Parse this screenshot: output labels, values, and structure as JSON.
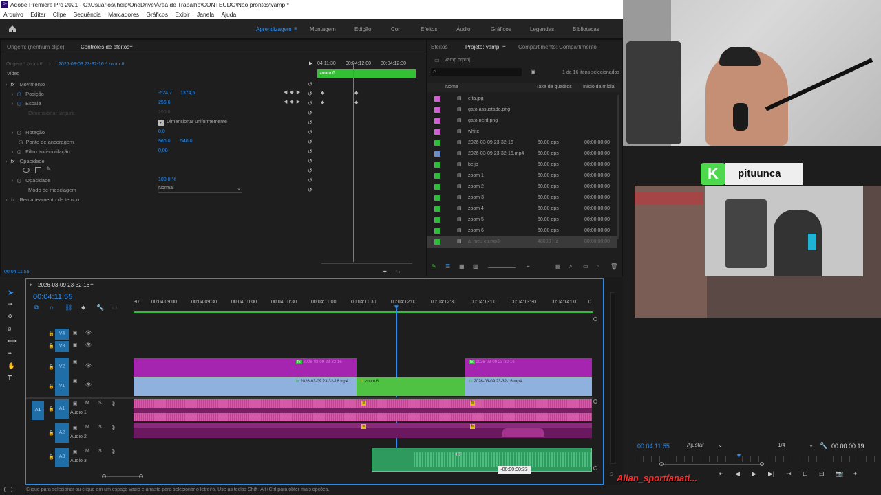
{
  "window": {
    "title": "Adobe Premiere Pro 2021 - C:\\Usuários\\jheip\\OneDrive\\Área de Trabalho\\CONTEUDO\\Não prontos\\vamp *",
    "app_badge": "Pr"
  },
  "menu": [
    "Arquivo",
    "Editar",
    "Clipe",
    "Sequência",
    "Marcadores",
    "Gráficos",
    "Exibir",
    "Janela",
    "Ajuda"
  ],
  "workspaces": [
    "Aprendizagem",
    "Montagem",
    "Edição",
    "Cor",
    "Efeitos",
    "Áudio",
    "Gráficos",
    "Legendas",
    "Bibliotecas"
  ],
  "effects_panel": {
    "tabs": [
      "Origem: (nenhum clipe)",
      "Controles de efeitos"
    ],
    "master": "Origem * zoom 6",
    "clip": "2026-03-09 23-32-16 * zoom 6",
    "video_label": "Vídeo",
    "clip_bar_label": "zoom 6",
    "times": [
      "04:11:30",
      "00:04:12:00",
      "00:04:12:30"
    ],
    "rows": [
      {
        "label": "Movimento",
        "v1": "",
        "v2": ""
      },
      {
        "label": "Posição",
        "v1": "-524,7",
        "v2": "1374,5"
      },
      {
        "label": "Escala",
        "v1": "255,6",
        "v2": ""
      },
      {
        "label": "Dimensionar largura",
        "v1": "100,0",
        "v2": ""
      },
      {
        "label": "Dimensionar uniformemente",
        "v1": "",
        "v2": ""
      },
      {
        "label": "Rotação",
        "v1": "0,0",
        "v2": ""
      },
      {
        "label": "Ponto de ancoragem",
        "v1": "960,0",
        "v2": "540,0"
      },
      {
        "label": "Filtro anti-cintilação",
        "v1": "0,00",
        "v2": ""
      },
      {
        "label": "Opacidade",
        "v1": "",
        "v2": ""
      },
      {
        "label": "Opacidade",
        "v1": "100,0 %",
        "v2": ""
      },
      {
        "label": "Modo de mesclagem",
        "v1": "Normal",
        "v2": ""
      },
      {
        "label": "Remapeamento de tempo",
        "v1": "",
        "v2": ""
      }
    ],
    "timecode": "00:04:11:55"
  },
  "project_panel": {
    "tabs": [
      "Efeitos",
      "Projeto: vamp",
      "Compartimento: Compartimento"
    ],
    "file": "vamp.prproj",
    "selection": "1 de 16 itens selecionados",
    "columns": [
      "Nome",
      "Taxa de quadros",
      "Início da mídia"
    ],
    "items": [
      {
        "name": "eita.jpg",
        "rate": "",
        "start": "",
        "color": "#d05fd0"
      },
      {
        "name": "gato assustado.png",
        "rate": "",
        "start": "",
        "color": "#d05fd0"
      },
      {
        "name": "gato nerd.png",
        "rate": "",
        "start": "",
        "color": "#d05fd0"
      },
      {
        "name": "white",
        "rate": "",
        "start": "",
        "color": "#d05fd0"
      },
      {
        "name": "2026-03-09 23-32-16",
        "rate": "60,00 qps",
        "start": "00:00:00:00",
        "color": "#2ebd3a"
      },
      {
        "name": "2026-03-09 23-32-16.mp4",
        "rate": "60,00 qps",
        "start": "00:00:00:00",
        "color": "#6c8cc8"
      },
      {
        "name": "beijo",
        "rate": "60,00 qps",
        "start": "00:00:00:00",
        "color": "#2ebd3a"
      },
      {
        "name": "zoom 1",
        "rate": "60,00 qps",
        "start": "00:00:00:00",
        "color": "#2ebd3a"
      },
      {
        "name": "zoom 2",
        "rate": "60,00 qps",
        "start": "00:00:00:00",
        "color": "#2ebd3a"
      },
      {
        "name": "zoom 3",
        "rate": "60,00 qps",
        "start": "00:00:00:00",
        "color": "#2ebd3a"
      },
      {
        "name": "zoom 4",
        "rate": "60,00 qps",
        "start": "00:00:00:00",
        "color": "#2ebd3a"
      },
      {
        "name": "zoom 5",
        "rate": "60,00 qps",
        "start": "00:00:00:00",
        "color": "#2ebd3a"
      },
      {
        "name": "zoom 6",
        "rate": "60,00 qps",
        "start": "00:00:00:00",
        "color": "#2ebd3a"
      },
      {
        "name": "ai meu cu.mp3",
        "rate": "48000 Hz",
        "start": "00:00:00:00",
        "color": "#2ebd3a"
      }
    ]
  },
  "timeline": {
    "sequence": "2026-03-09 23-32-16",
    "timecode": "00:04:11:55",
    "ruler": [
      "30",
      "00:04:09:00",
      "00:04:09:30",
      "00:04:10:00",
      "00:04:10:30",
      "00:04:11:00",
      "00:04:11:30",
      "00:04:12:00",
      "00:04:12:30",
      "00:04:13:00",
      "00:04:13:30",
      "00:04:14:00",
      "0"
    ],
    "tracks": [
      "V4",
      "V3",
      "V2",
      "V1",
      "A1",
      "A2",
      "A3"
    ],
    "track_names": {
      "a1": "Áudio 1",
      "a2": "Áudio 2",
      "a3": "Áudio 3"
    },
    "clips": {
      "v1a": "2026-03-09 23-32-16.mp4",
      "v1b": "zoom 6",
      "v1c": "2026-03-09 23-32-16.mp4",
      "v2a": "2026-03-09 23-32-16",
      "v2b": "2026-03-09 23-32-16"
    },
    "tooltip": "-00:00:00:33",
    "ms": [
      "M",
      "S"
    ]
  },
  "program": {
    "timecode": "00:04:11:55",
    "fit": "Ajustar",
    "res": "1/4",
    "duration": "00:00:00:19"
  },
  "statusbar": "Clique para selecionar ou clique em um espaço vazio e arraste para selecionar o letreiro. Use as teclas Shift+Alt+Ctrl para obter mais opções.",
  "overlay": {
    "streamer": "pituunca",
    "kick_logo": "K",
    "username": "Allan_sportfanati..."
  }
}
